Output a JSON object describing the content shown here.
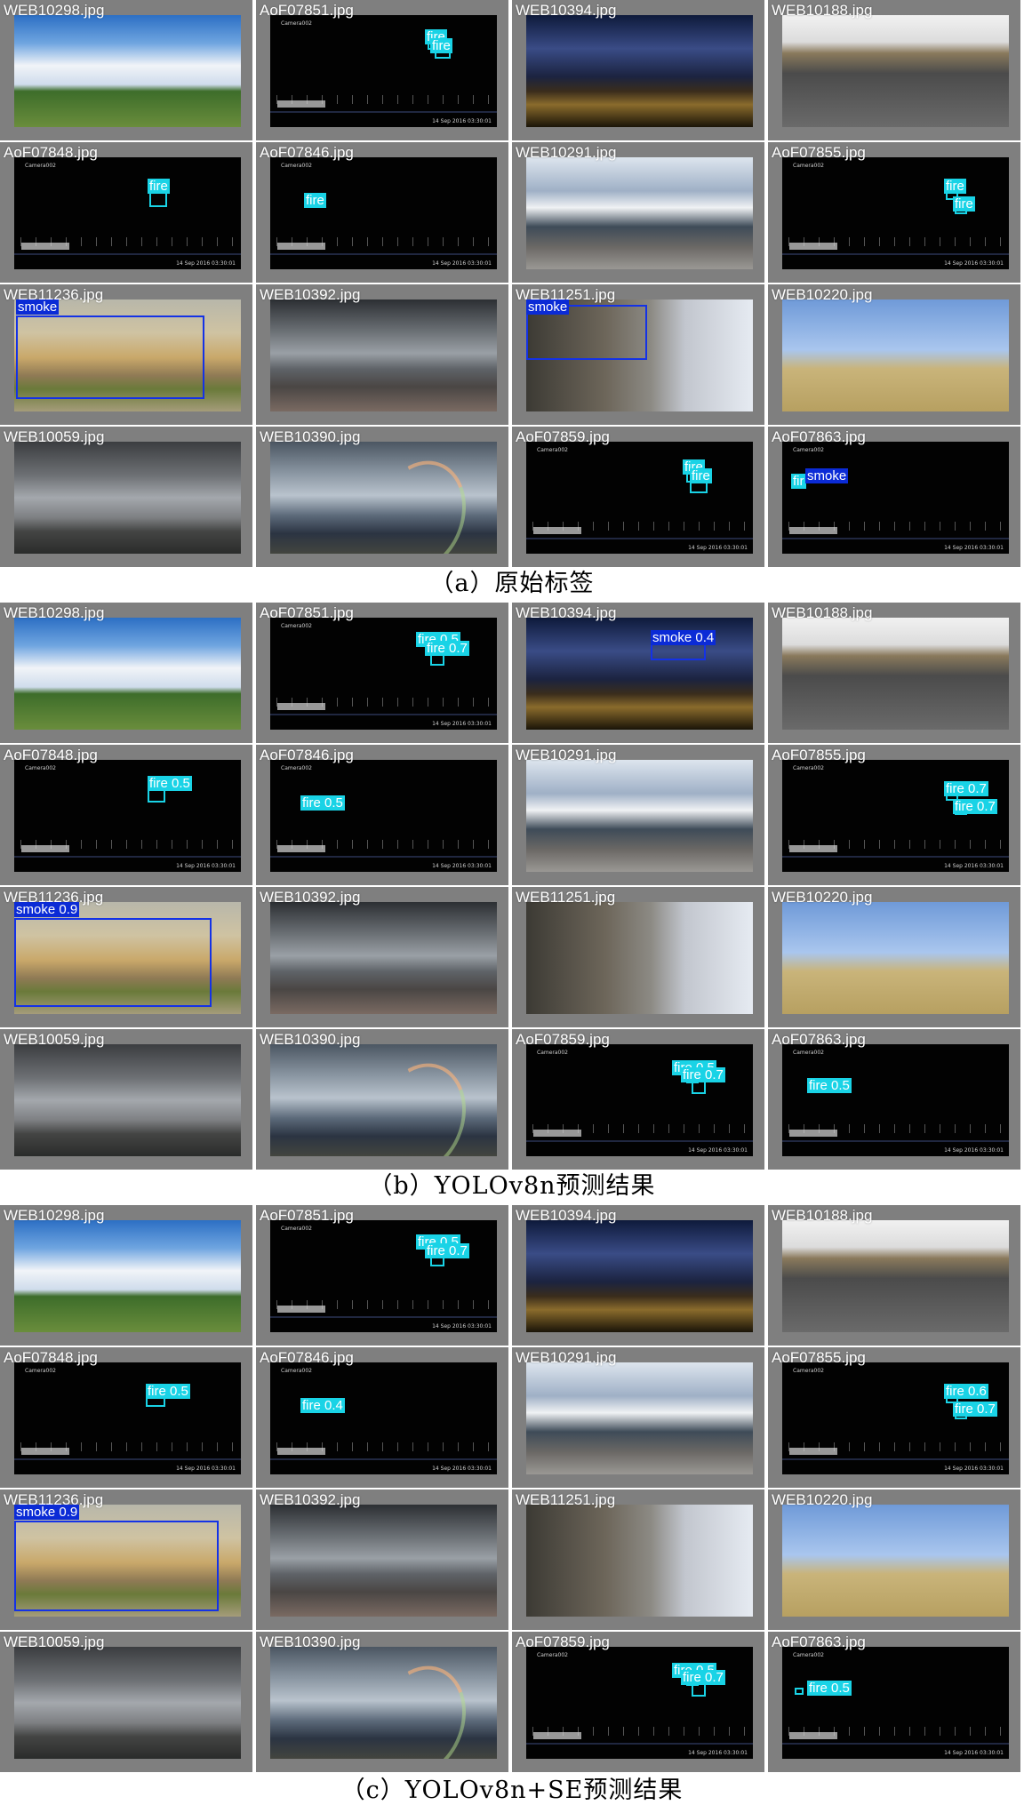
{
  "colors": {
    "frame": "#7f7f7f",
    "fire": "#19d3e6",
    "smoke": "#1432e6",
    "smoke_dark": "#0b2bd6"
  },
  "panels": [
    {
      "caption": "（a）原始标签",
      "cells": [
        {
          "label": "WEB10298.jpg",
          "scene": "sky-day",
          "dets": []
        },
        {
          "label": "AoF07851.jpg",
          "scene": "night",
          "dets": [
            {
              "cls": "fire",
              "text": "fire"
            },
            {
              "cls": "fire",
              "text": "fire"
            }
          ]
        },
        {
          "label": "WEB10394.jpg",
          "scene": "city-night",
          "dets": []
        },
        {
          "label": "WEB10188.jpg",
          "scene": "parking",
          "dets": []
        },
        {
          "label": "AoF07848.jpg",
          "scene": "night",
          "dets": [
            {
              "cls": "fire",
              "text": "fire"
            }
          ]
        },
        {
          "label": "AoF07846.jpg",
          "scene": "night",
          "dets": [
            {
              "cls": "fire",
              "text": "fire"
            }
          ]
        },
        {
          "label": "WEB10291.jpg",
          "scene": "building",
          "dets": []
        },
        {
          "label": "AoF07855.jpg",
          "scene": "night",
          "dets": [
            {
              "cls": "fire",
              "text": "fire"
            },
            {
              "cls": "fire",
              "text": "fire"
            }
          ]
        },
        {
          "label": "WEB11236.jpg",
          "scene": "smoke",
          "dets": [
            {
              "cls": "smoke",
              "text": "smoke"
            }
          ]
        },
        {
          "label": "WEB10392.jpg",
          "scene": "storm",
          "dets": []
        },
        {
          "label": "WEB11251.jpg",
          "scene": "facade",
          "dets": [
            {
              "cls": "smoke",
              "text": "smoke"
            }
          ]
        },
        {
          "label": "WEB10220.jpg",
          "scene": "field",
          "dets": []
        },
        {
          "label": "WEB10059.jpg",
          "scene": "storm2",
          "dets": []
        },
        {
          "label": "WEB10390.jpg",
          "scene": "rainbow",
          "dets": []
        },
        {
          "label": "AoF07859.jpg",
          "scene": "night",
          "dets": [
            {
              "cls": "fire",
              "text": "fire"
            },
            {
              "cls": "fire",
              "text": "fire"
            }
          ]
        },
        {
          "label": "AoF07863.jpg",
          "scene": "night",
          "dets": [
            {
              "cls": "fire",
              "text": "fir"
            },
            {
              "cls": "smoke",
              "text": "smoke"
            }
          ]
        }
      ]
    },
    {
      "caption": "（b）YOLOv8n预测结果",
      "cells": [
        {
          "label": "WEB10298.jpg",
          "scene": "sky-day",
          "dets": []
        },
        {
          "label": "AoF07851.jpg",
          "scene": "night",
          "dets": [
            {
              "cls": "fire",
              "text": "fire 0.5"
            },
            {
              "cls": "fire",
              "text": "fire 0.7"
            }
          ]
        },
        {
          "label": "WEB10394.jpg",
          "scene": "city-night",
          "dets": [
            {
              "cls": "smoke",
              "text": "smoke 0.4"
            }
          ]
        },
        {
          "label": "WEB10188.jpg",
          "scene": "parking",
          "dets": []
        },
        {
          "label": "AoF07848.jpg",
          "scene": "night",
          "dets": [
            {
              "cls": "fire",
              "text": "fire 0.5"
            }
          ]
        },
        {
          "label": "AoF07846.jpg",
          "scene": "night",
          "dets": [
            {
              "cls": "fire",
              "text": "fire 0.5"
            }
          ]
        },
        {
          "label": "WEB10291.jpg",
          "scene": "building",
          "dets": []
        },
        {
          "label": "AoF07855.jpg",
          "scene": "night",
          "dets": [
            {
              "cls": "fire",
              "text": "fire 0.7"
            },
            {
              "cls": "fire",
              "text": "fire 0.7"
            }
          ]
        },
        {
          "label": "WEB11236.jpg",
          "scene": "smoke",
          "dets": [
            {
              "cls": "smoke",
              "text": "smoke 0.9"
            }
          ]
        },
        {
          "label": "WEB10392.jpg",
          "scene": "storm",
          "dets": []
        },
        {
          "label": "WEB11251.jpg",
          "scene": "facade",
          "dets": []
        },
        {
          "label": "WEB10220.jpg",
          "scene": "field",
          "dets": []
        },
        {
          "label": "WEB10059.jpg",
          "scene": "storm2",
          "dets": []
        },
        {
          "label": "WEB10390.jpg",
          "scene": "rainbow",
          "dets": []
        },
        {
          "label": "AoF07859.jpg",
          "scene": "night",
          "dets": [
            {
              "cls": "fire",
              "text": "fire 0.5"
            },
            {
              "cls": "fire",
              "text": "fire 0.7"
            }
          ]
        },
        {
          "label": "AoF07863.jpg",
          "scene": "night",
          "dets": [
            {
              "cls": "fire",
              "text": "fire 0.5"
            }
          ]
        }
      ]
    },
    {
      "caption": "（c）YOLOv8n+SE预测结果",
      "cells": [
        {
          "label": "WEB10298.jpg",
          "scene": "sky-day",
          "dets": []
        },
        {
          "label": "AoF07851.jpg",
          "scene": "night",
          "dets": [
            {
              "cls": "fire",
              "text": "fire 0.5"
            },
            {
              "cls": "fire",
              "text": "fire 0.7"
            }
          ]
        },
        {
          "label": "WEB10394.jpg",
          "scene": "city-night",
          "dets": []
        },
        {
          "label": "WEB10188.jpg",
          "scene": "parking",
          "dets": []
        },
        {
          "label": "AoF07848.jpg",
          "scene": "night",
          "dets": [
            {
              "cls": "fire",
              "text": "fire 0.5"
            }
          ]
        },
        {
          "label": "AoF07846.jpg",
          "scene": "night",
          "dets": [
            {
              "cls": "fire",
              "text": "fire 0.4"
            }
          ]
        },
        {
          "label": "WEB10291.jpg",
          "scene": "building",
          "dets": []
        },
        {
          "label": "AoF07855.jpg",
          "scene": "night",
          "dets": [
            {
              "cls": "fire",
              "text": "fire 0.6"
            },
            {
              "cls": "fire",
              "text": "fire 0.7"
            }
          ]
        },
        {
          "label": "WEB11236.jpg",
          "scene": "smoke",
          "dets": [
            {
              "cls": "smoke",
              "text": "smoke 0.9"
            }
          ]
        },
        {
          "label": "WEB10392.jpg",
          "scene": "storm",
          "dets": []
        },
        {
          "label": "WEB11251.jpg",
          "scene": "facade",
          "dets": []
        },
        {
          "label": "WEB10220.jpg",
          "scene": "field",
          "dets": []
        },
        {
          "label": "WEB10059.jpg",
          "scene": "storm2",
          "dets": []
        },
        {
          "label": "WEB10390.jpg",
          "scene": "rainbow",
          "dets": []
        },
        {
          "label": "AoF07859.jpg",
          "scene": "night",
          "dets": [
            {
              "cls": "fire",
              "text": "fire 0.5"
            },
            {
              "cls": "fire",
              "text": "fire 0.7"
            }
          ]
        },
        {
          "label": "AoF07863.jpg",
          "scene": "night",
          "dets": [
            {
              "cls": "fire",
              "text": "fire 0.5"
            }
          ]
        }
      ]
    }
  ]
}
